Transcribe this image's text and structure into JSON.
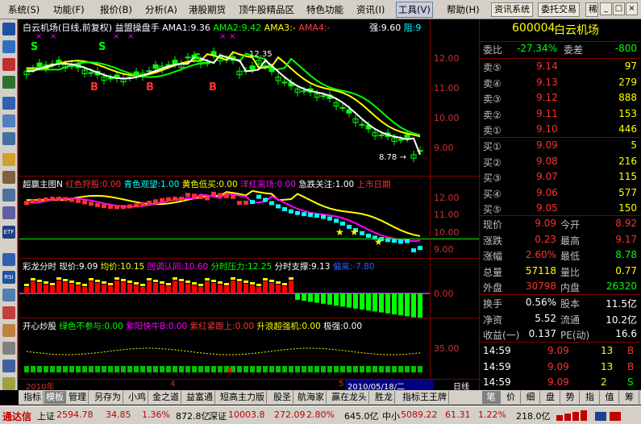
{
  "menu": {
    "items": [
      "系统(S)",
      "功能(F)",
      "报价(B)",
      "分析(A)",
      "港股期货",
      "顶牛股精品区",
      "特色功能",
      "资讯(I)",
      "工具(V)",
      "帮助(H)"
    ],
    "active_index": 8,
    "sys_btn1": "资讯系统",
    "sys_btn2": "委托交易",
    "sys_btn3": "稀"
  },
  "panel1": {
    "title": "白云机场(日线,前复权)",
    "indicator": "益盟操盘手",
    "ama1": "AMA1:9.36",
    "ama2": "AMA2:9.42",
    "ama3": "AMA3:-",
    "ama4": "AMA4:-",
    "strength": "强:9.60",
    "resist": "阻:9",
    "high_label": "12.35",
    "low_label": "8.78",
    "y_labels": [
      "12.00",
      "11.00",
      "10.00",
      "9.00"
    ],
    "signals": [
      "S",
      "S",
      "S",
      "B",
      "B",
      "B"
    ]
  },
  "panel2": {
    "title": "超赢主图N",
    "red": "红色狩股:0.00",
    "cyan": "青色观望:1.00",
    "yellow": "黄色低买:0.00",
    "magenta": "洋红离场:0.00",
    "white": "急跌关注:1.00",
    "red2": "上市日期",
    "y_labels": [
      "12.00",
      "11.00",
      "10.00",
      "9.00"
    ]
  },
  "panel3": {
    "title": "彩龙分时",
    "price": "现价:9.09",
    "avg": "均价:10.15",
    "pullback": "回调认同:10.60",
    "pressure": "分时压力:12.25",
    "support": "分时支撑:9.13",
    "deviation": "偏离:-7.80",
    "zero": "0.00"
  },
  "panel4": {
    "title": "开心炒股",
    "green": "绿色不参与:0.00",
    "purple": "紫阳快牛B:0.00",
    "purplered": "紫红紧跟上:0.00",
    "lift": "升浪超强机:0.00",
    "extreme": "极强:0.00",
    "y_label": "35.00"
  },
  "xaxis": {
    "year": "2010年",
    "m4": "4",
    "m5": "5",
    "date": "2010/05/18/二",
    "period": "日线"
  },
  "quote": {
    "code": "600004",
    "name": "白云机场",
    "weibi_label": "委比",
    "weibi": "-27.34%",
    "weicha_label": "委差",
    "weicha": "-800",
    "sells": [
      {
        "label": "卖⑤",
        "price": "9.14",
        "vol": "97"
      },
      {
        "label": "卖④",
        "price": "9.13",
        "vol": "279"
      },
      {
        "label": "卖③",
        "price": "9.12",
        "vol": "888"
      },
      {
        "label": "卖②",
        "price": "9.11",
        "vol": "153"
      },
      {
        "label": "卖①",
        "price": "9.10",
        "vol": "446"
      }
    ],
    "buys": [
      {
        "label": "买①",
        "price": "9.09",
        "vol": "5"
      },
      {
        "label": "买②",
        "price": "9.08",
        "vol": "216"
      },
      {
        "label": "买③",
        "price": "9.07",
        "vol": "115"
      },
      {
        "label": "买④",
        "price": "9.06",
        "vol": "577"
      },
      {
        "label": "买⑤",
        "price": "9.05",
        "vol": "150"
      }
    ],
    "stats": [
      {
        "l1": "现价",
        "v1": "9.09",
        "l2": "今开",
        "v2": "8.92"
      },
      {
        "l1": "涨跌",
        "v1": "0.23",
        "l2": "最高",
        "v2": "9.17"
      },
      {
        "l1": "涨幅",
        "v1": "2.60%",
        "l2": "最低",
        "v2": "8.78"
      },
      {
        "l1": "总量",
        "v1": "57118",
        "l2": "量比",
        "v2": "0.77"
      },
      {
        "l1": "外盘",
        "v1": "30798",
        "l2": "内盘",
        "v2": "26320"
      }
    ],
    "stats2": [
      {
        "l1": "换手",
        "v1": "0.56%",
        "l2": "股本",
        "v2": "11.5亿"
      },
      {
        "l1": "净资",
        "v1": "5.52",
        "l2": "流通",
        "v2": "10.2亿"
      },
      {
        "l1": "收益(一)",
        "v1": "0.137",
        "l2": "PE(动)",
        "v2": "16.6"
      }
    ],
    "ticks": [
      {
        "t": "14:59",
        "p": "9.09",
        "v": "13",
        "s": "B"
      },
      {
        "t": "14:59",
        "p": "9.09",
        "v": "13",
        "s": "B"
      },
      {
        "t": "14:59",
        "p": "9.09",
        "v": "2",
        "s": "S"
      }
    ]
  },
  "tabs": [
    "指标",
    "模板",
    "管理",
    "另存为",
    "小鸡",
    "金之道",
    "益富通",
    "短高主力版",
    "股圣",
    "航海家",
    "赢在龙头",
    "胜龙",
    "指标王王牌"
  ],
  "rtabs": [
    "笔",
    "价",
    "细",
    "盘",
    "势",
    "指",
    "值",
    "筹"
  ],
  "status": {
    "brand": "通达信",
    "sh_label": "上证",
    "sh": "2594.78",
    "sh_chg": "34.85",
    "sh_pct": "1.36%",
    "sh_amt": "872.8亿",
    "sz_label": "深证",
    "sz": "10003.8",
    "sz_chg": "272.09",
    "sz_pct": "2.80%",
    "sz_amt": "645.0亿",
    "zx_label": "中小",
    "zx": "5089.22",
    "zx_chg": "61.31",
    "zx_pct": "1.22%",
    "zx_amt": "218.0亿"
  }
}
